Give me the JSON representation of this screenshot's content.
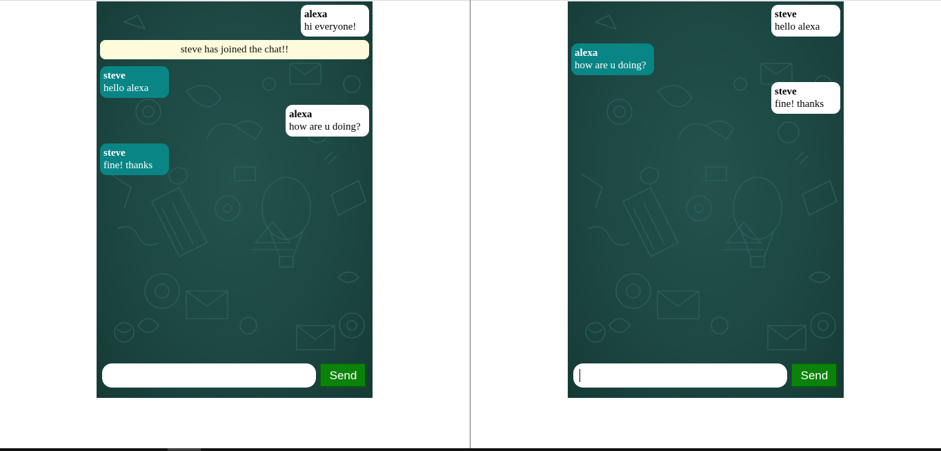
{
  "left_chat": {
    "messages": [
      {
        "sender": "alexa",
        "text": "hi everyone!"
      },
      {
        "notice": "steve has joined the chat!!"
      },
      {
        "sender": "steve",
        "text": "hello alexa"
      },
      {
        "sender": "alexa",
        "text": "how are u doing?"
      },
      {
        "sender": "steve",
        "text": "fine! thanks"
      }
    ],
    "input_value": "",
    "send_label": "Send"
  },
  "right_chat": {
    "messages": [
      {
        "sender": "steve",
        "text": "hello alexa"
      },
      {
        "sender": "alexa",
        "text": "how are u doing?"
      },
      {
        "sender": "steve",
        "text": "fine! thanks"
      }
    ],
    "input_value": "",
    "send_label": "Send"
  },
  "colors": {
    "outgoing_bubble": "#ffffff",
    "incoming_bubble": "#0a8585",
    "notice_bubble": "#fdfbdc",
    "send_button": "#0b830b",
    "chat_background": "#1d4843"
  }
}
